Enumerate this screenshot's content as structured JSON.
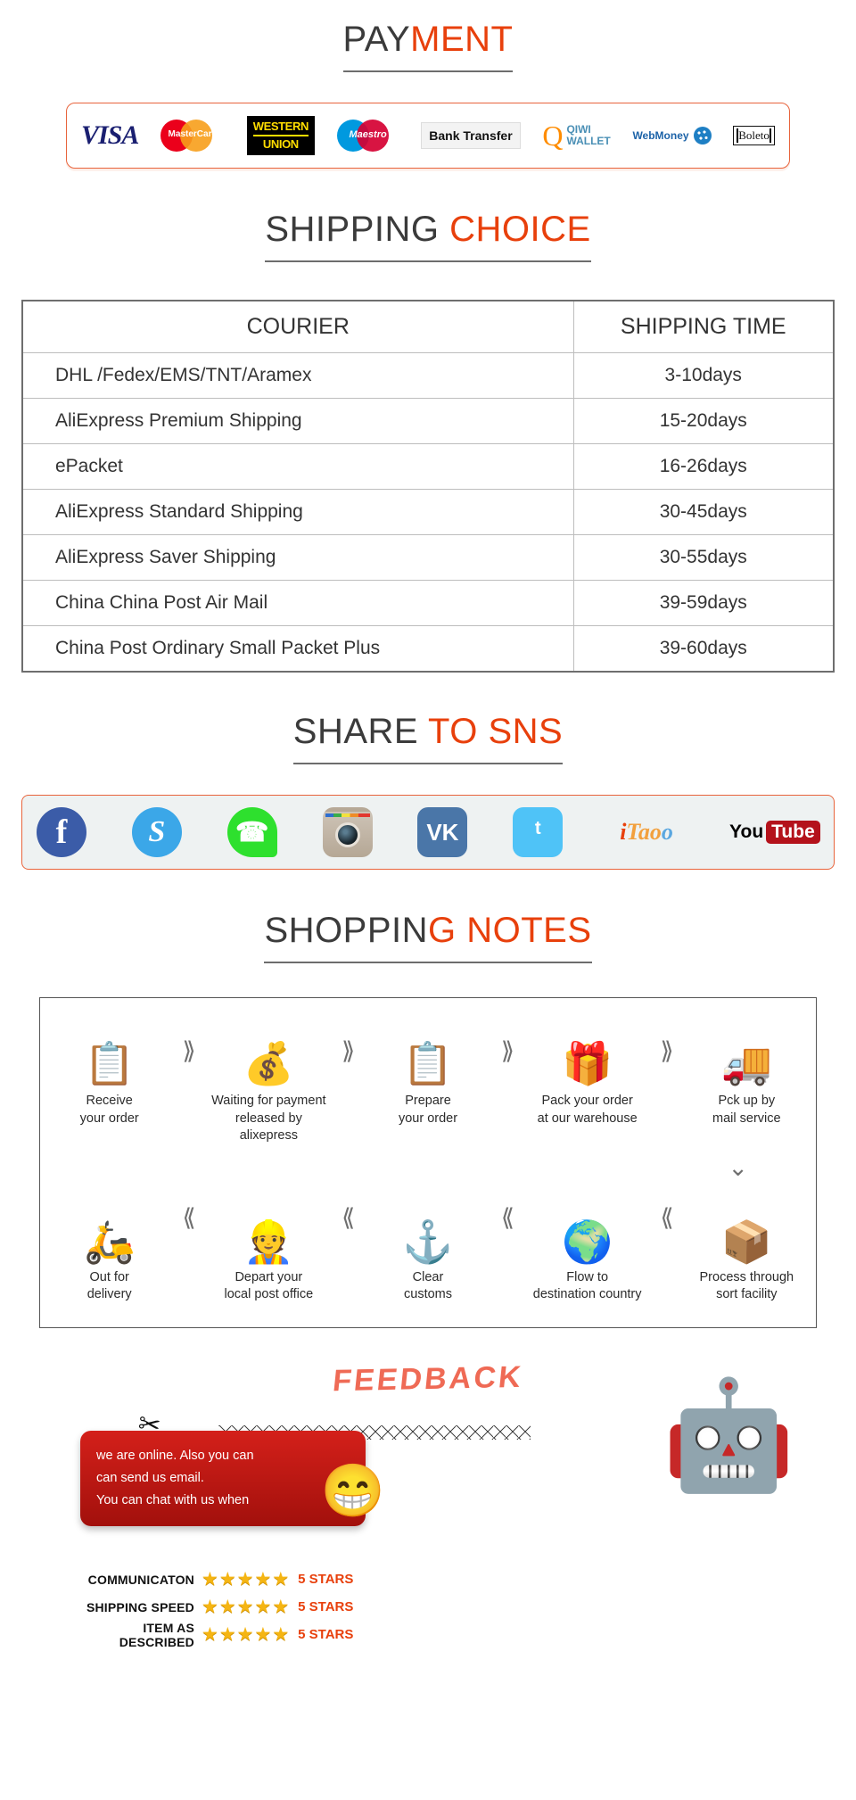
{
  "payment": {
    "heading_dark": "PAY",
    "heading_accent": "MENT",
    "methods": [
      {
        "name": "visa",
        "label": "VISA"
      },
      {
        "name": "mastercard",
        "label": "MasterCard"
      },
      {
        "name": "western-union",
        "label_top": "WESTERN",
        "label_bottom": "UNION"
      },
      {
        "name": "maestro",
        "label": "Maestro"
      },
      {
        "name": "bank-transfer",
        "label": "Bank Transfer"
      },
      {
        "name": "qiwi-wallet",
        "label_top": "QIWI",
        "label_bottom": "WALLET",
        "mark": "Q"
      },
      {
        "name": "webmoney",
        "label": "WebMoney"
      },
      {
        "name": "boleto",
        "label": "Boleto"
      }
    ]
  },
  "shipping": {
    "heading_dark": "SHIPPING",
    "heading_accent": " CHOICE",
    "columns": [
      "COURIER",
      "SHIPPING TIME"
    ],
    "rows": [
      {
        "courier": "DHL /Fedex/EMS/TNT/Aramex",
        "time": "3-10days"
      },
      {
        "courier": "AliExpress Premium Shipping",
        "time": "15-20days"
      },
      {
        "courier": "ePacket",
        "time": "16-26days"
      },
      {
        "courier": "AliExpress Standard Shipping",
        "time": "30-45days"
      },
      {
        "courier": "AliExpress Saver Shipping",
        "time": "30-55days"
      },
      {
        "courier": "China China Post Air Mail",
        "time": "39-59days"
      },
      {
        "courier": "China Post Ordinary Small Packet Plus",
        "time": "39-60days"
      }
    ]
  },
  "sns": {
    "heading_dark": "SHARE",
    "heading_accent": " TO SNS",
    "icons": [
      {
        "name": "facebook-icon",
        "glyph": "f"
      },
      {
        "name": "skype-icon",
        "glyph": "S"
      },
      {
        "name": "whatsapp-icon",
        "glyph": "☎"
      },
      {
        "name": "instagram-icon",
        "glyph": ""
      },
      {
        "name": "vk-icon",
        "glyph": "VK"
      },
      {
        "name": "twitter-icon",
        "glyph": "ᵗ"
      },
      {
        "name": "itao-icon",
        "part1": "i",
        "part2": "Tao",
        "part3": "o"
      },
      {
        "name": "youtube-icon",
        "part1": "You",
        "part2": "Tube"
      }
    ]
  },
  "notes": {
    "heading_dark": "SHOPPIN",
    "heading_accent": "G NOTES",
    "row1": [
      {
        "icon": "📋",
        "icon_name": "clipboard-icon",
        "line1": "Receive",
        "line2": "your order"
      },
      {
        "icon": "💰",
        "icon_name": "money-bag-icon",
        "line1": "Waiting for payment",
        "line2": "released by alixepress"
      },
      {
        "icon": "📋",
        "icon_name": "clipboard-icon",
        "line1": "Prepare",
        "line2": "your order"
      },
      {
        "icon": "🎁",
        "icon_name": "gift-icon",
        "line1": "Pack your order",
        "line2": "at our warehouse"
      },
      {
        "icon": "🚚",
        "icon_name": "truck-icon",
        "line1": "Pck up by",
        "line2": "mail service"
      }
    ],
    "row2": [
      {
        "icon": "🛵",
        "icon_name": "scooter-icon",
        "line1": "Out for",
        "line2": "delivery"
      },
      {
        "icon": "👷",
        "icon_name": "postman-icon",
        "line1": "Depart your",
        "line2": "local post office"
      },
      {
        "icon": "⚓",
        "icon_name": "anchor-icon",
        "line1": "Clear",
        "line2": "customs"
      },
      {
        "icon": "🌍",
        "icon_name": "globe-icon",
        "line1": "Flow to",
        "line2": "destination country"
      },
      {
        "icon": "📦",
        "icon_name": "parcel-cart-icon",
        "line1": "Process through",
        "line2": "sort facility"
      }
    ],
    "forward_arrow": "⟫",
    "back_arrow": "⟪",
    "turn_arrow": "⌄"
  },
  "feedback": {
    "title": "FEEDBACK",
    "bubble": {
      "line1": "we are online. Also you can",
      "line2": "can send us email.",
      "line3": "You can chat with us when",
      "emoji": "😁"
    },
    "ratings": [
      {
        "label": "COMMUNICATON",
        "stars": 5,
        "value": "5 STARS"
      },
      {
        "label": "SHIPPING SPEED",
        "stars": 5,
        "value": "5 STARS"
      },
      {
        "label": "ITEM AS DESCRIBED",
        "stars": 5,
        "value": "5 STARS"
      }
    ],
    "star_glyph": "★",
    "mascot_icon": "🤖"
  },
  "colors": {
    "accent": "#e8400c",
    "dark_text": "#3b3b3b",
    "bubble_red": "#d4201a",
    "star_gold": "#f5b513"
  }
}
